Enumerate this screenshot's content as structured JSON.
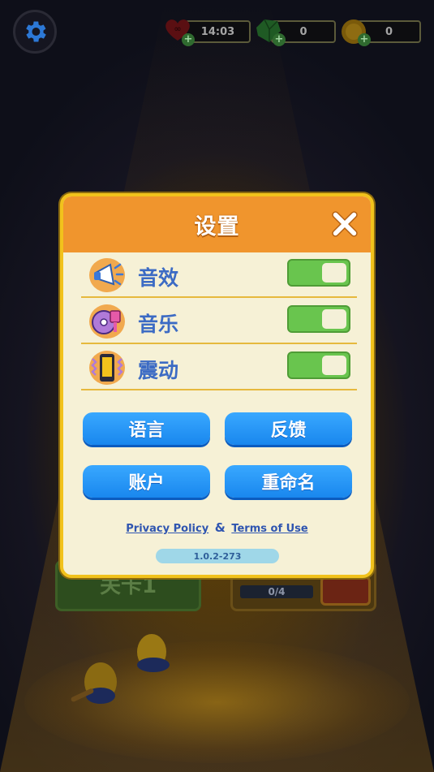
{
  "hud": {
    "lives": {
      "icon": "heart-infinity-icon",
      "value": "14:03"
    },
    "gems": {
      "icon": "green-gem-icon",
      "value": "0"
    },
    "coins": {
      "icon": "gold-coin-icon",
      "value": "0"
    },
    "settings_icon": "gear-icon"
  },
  "background": {
    "level_button_label": "关卡1",
    "chest_progress": "0/4"
  },
  "dialog": {
    "title": "设置",
    "close_icon": "close-icon",
    "settings": [
      {
        "label": "音效",
        "icon": "megaphone-icon",
        "enabled": true
      },
      {
        "label": "音乐",
        "icon": "music-disc-icon",
        "enabled": true
      },
      {
        "label": "震动",
        "icon": "vibrate-phone-icon",
        "enabled": true
      }
    ],
    "buttons": {
      "language": "语言",
      "feedback": "反馈",
      "account": "账户",
      "rename": "重命名"
    },
    "links": {
      "privacy": "Privacy Policy",
      "and": "&",
      "terms": "Terms of Use"
    },
    "version": "1.0.2-273"
  },
  "colors": {
    "header": "#f0952d",
    "panel": "#f6f1d6",
    "border": "#f1c21c",
    "toggle_on": "#69c54e",
    "button_blue": "#1987ee",
    "label_blue": "#3c6bc4"
  }
}
